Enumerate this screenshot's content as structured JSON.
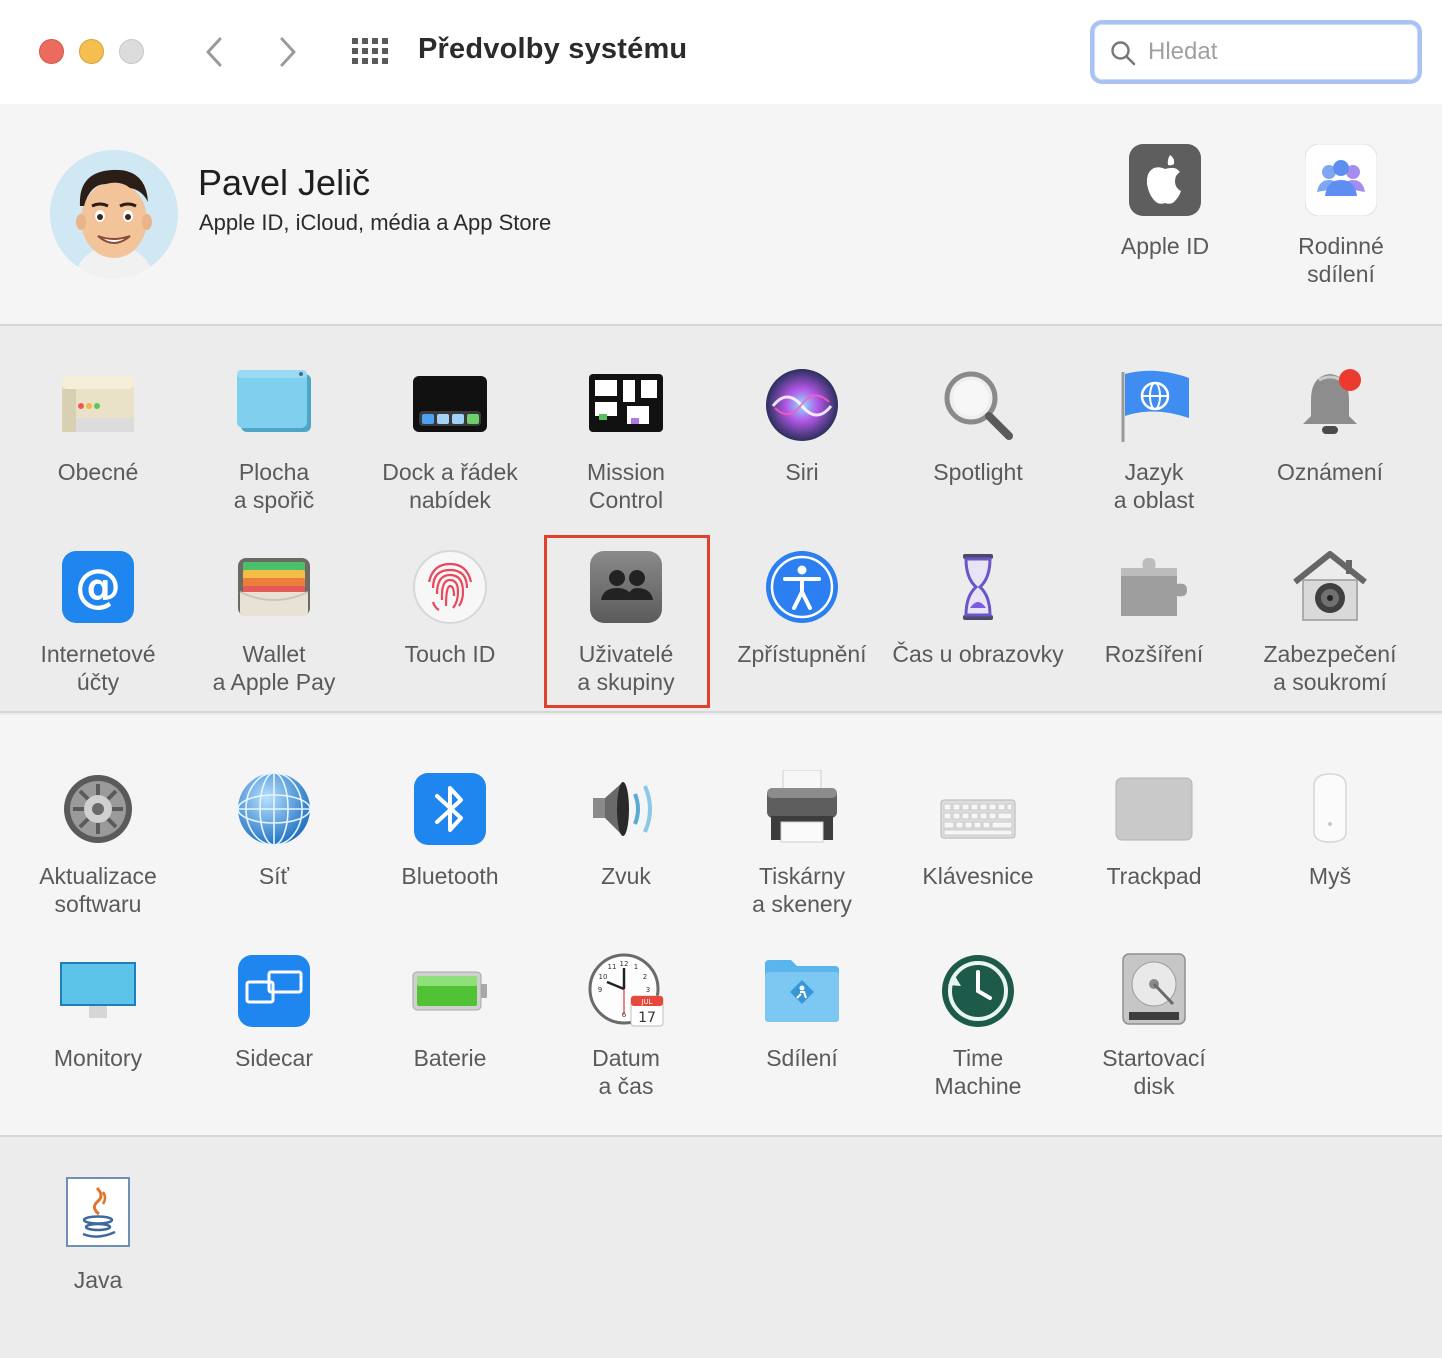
{
  "window": {
    "title": "Předvolby systému"
  },
  "search": {
    "placeholder": "Hledat",
    "value": ""
  },
  "account": {
    "name": "Pavel Jelič",
    "subtitle": "Apple ID, iCloud, média a App Store",
    "items": [
      {
        "label": "Apple ID",
        "icon": "apple-logo-icon"
      },
      {
        "label": "Rodinné sdílení",
        "icon": "family-sharing-icon"
      }
    ]
  },
  "section1": [
    {
      "label": "Obecné",
      "icon": "general-icon"
    },
    {
      "label": "Plocha a spořič",
      "icon": "desktop-screensaver-icon"
    },
    {
      "label": "Dock a řádek nabídek",
      "icon": "dock-icon"
    },
    {
      "label": "Mission Control",
      "icon": "mission-control-icon"
    },
    {
      "label": "Siri",
      "icon": "siri-icon"
    },
    {
      "label": "Spotlight",
      "icon": "spotlight-icon"
    },
    {
      "label": "Jazyk a oblast",
      "icon": "language-region-icon"
    },
    {
      "label": "Oznámení",
      "icon": "notifications-icon"
    },
    {
      "label": "Internetové účty",
      "icon": "internet-accounts-icon"
    },
    {
      "label": "Wallet a Apple Pay",
      "icon": "wallet-icon"
    },
    {
      "label": "Touch ID",
      "icon": "touch-id-icon"
    },
    {
      "label": "Uživatelé a skupiny",
      "icon": "users-groups-icon"
    },
    {
      "label": "Zpřístupnění",
      "icon": "accessibility-icon"
    },
    {
      "label": "Čas u obrazovky",
      "icon": "screen-time-icon"
    },
    {
      "label": "Rozšíření",
      "icon": "extensions-icon"
    },
    {
      "label": "Zabezpečení a soukromí",
      "icon": "security-privacy-icon"
    }
  ],
  "section2": [
    {
      "label": "Aktualizace softwaru",
      "icon": "software-update-icon"
    },
    {
      "label": "Síť",
      "icon": "network-icon"
    },
    {
      "label": "Bluetooth",
      "icon": "bluetooth-icon"
    },
    {
      "label": "Zvuk",
      "icon": "sound-icon"
    },
    {
      "label": "Tiskárny a skenery",
      "icon": "printers-scanners-icon"
    },
    {
      "label": "Klávesnice",
      "icon": "keyboard-icon"
    },
    {
      "label": "Trackpad",
      "icon": "trackpad-icon"
    },
    {
      "label": "Myš",
      "icon": "mouse-icon"
    },
    {
      "label": "Monitory",
      "icon": "displays-icon"
    },
    {
      "label": "Sidecar",
      "icon": "sidecar-icon"
    },
    {
      "label": "Baterie",
      "icon": "battery-icon"
    },
    {
      "label": "Datum a čas",
      "icon": "date-time-icon"
    },
    {
      "label": "Sdílení",
      "icon": "sharing-icon"
    },
    {
      "label": "Time Machine",
      "icon": "time-machine-icon"
    },
    {
      "label": "Startovací disk",
      "icon": "startup-disk-icon"
    }
  ],
  "section3": [
    {
      "label": "Java",
      "icon": "java-icon"
    }
  ],
  "calendar_icon": {
    "month": "JUL",
    "day": "17"
  },
  "colors": {
    "highlight": "#e0402c",
    "search_focus": "#a8c3f2",
    "close": "#ed6a5e",
    "minimize": "#f5bf4f"
  }
}
